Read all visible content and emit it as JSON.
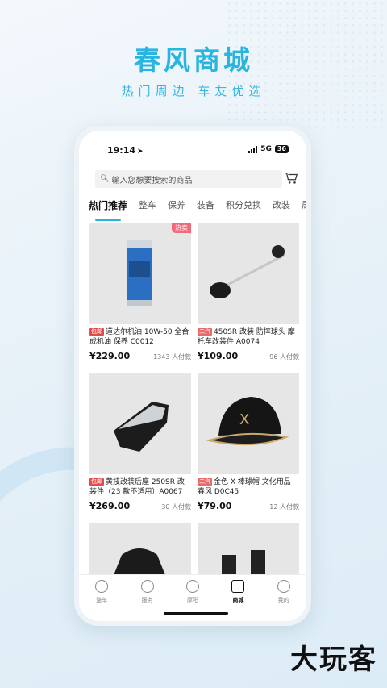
{
  "hero": {
    "title": "春风商城",
    "subtitle": "热门周边  车友优选"
  },
  "status": {
    "time": "19:14",
    "network": "5G",
    "battery": "36"
  },
  "search": {
    "placeholder": "输入您想要搜索的商品"
  },
  "tabs": [
    "热门推荐",
    "整车",
    "保养",
    "装备",
    "积分兑换",
    "改装",
    "周边"
  ],
  "products": [
    {
      "badge": "包邮",
      "title": "道达尔机油 10W-50 全合成机油 保养 C0012",
      "price": "¥229.00",
      "sold": "1343 人付款",
      "tag": "热卖"
    },
    {
      "badge": "二汽",
      "title": "450SR 改装 防摔球头 摩托车改装件 A0074",
      "price": "¥109.00",
      "sold": "96 人付款"
    },
    {
      "badge": "包邮",
      "title": "黄技改装后座 250SR 改装件（23 款不适用）A0067",
      "price": "¥269.00",
      "sold": "30 人付款"
    },
    {
      "badge": "二汽",
      "title": "金色 X 棒球帽 文化用品 春风 D0C45",
      "price": "¥79.00",
      "sold": "12 人付款"
    }
  ],
  "tabbar": [
    "整车",
    "服务",
    "摩阳",
    "商城",
    "我的"
  ],
  "watermark": "大玩客",
  "colors": {
    "accent": "#2ab4e0",
    "price_badge": "#e34a4a",
    "hot_tag": "#f06a7a"
  }
}
